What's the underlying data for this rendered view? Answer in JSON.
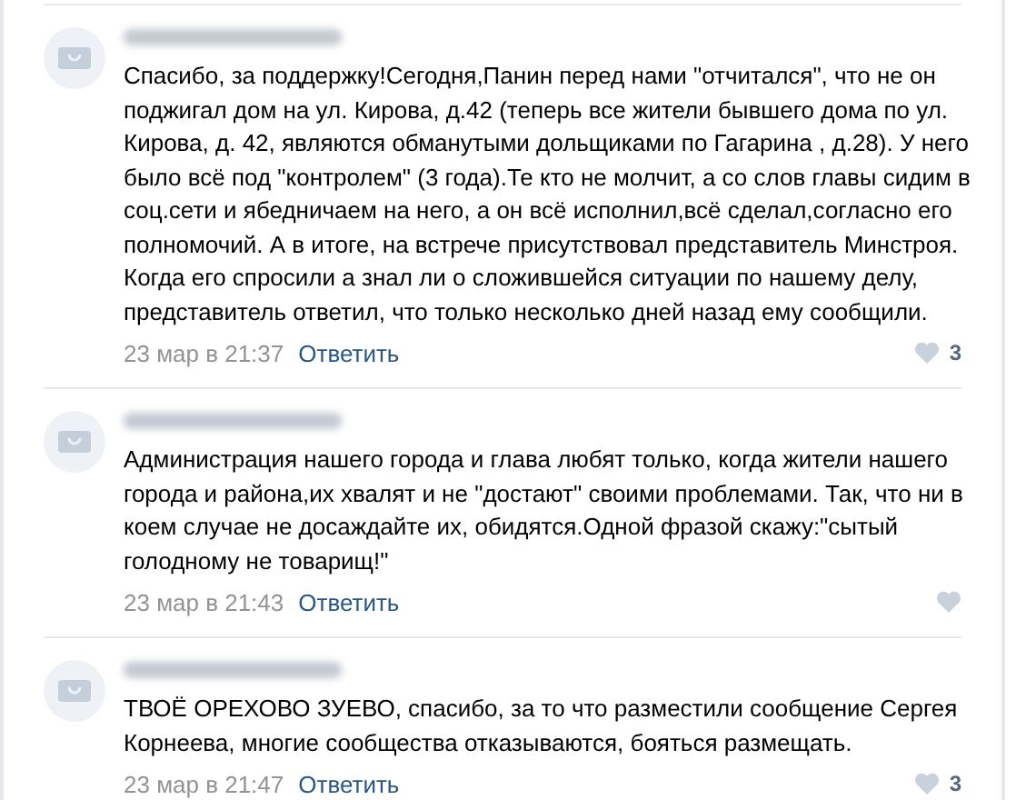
{
  "comments": [
    {
      "text": "Спасибо, за поддержку!Сегодня,Панин перед нами \"отчитался\", что не он поджигал дом на ул. Кирова, д.42 (теперь все жители бывшего дома по ул. Кирова, д. 42, являются обманутыми дольщиками по Гагарина , д.28). У него было всё под \"контролем\" (3 года).Те кто не молчит, а со слов главы сидим в соц.сети и ябедничаем на него, а он всё исполнил,всё сделал,согласно его полномочий. А в итоге, на встрече присутствовал представитель Минстроя. Когда его спросили а знал ли о сложившейся ситуации по нашему делу, представитель ответил, что только несколько дней назад ему сообщили.",
      "date": "23 мар в 21:37",
      "reply": "Ответить",
      "likes": "3"
    },
    {
      "text": "Администрация нашего города и глава любят только, когда жители нашего города и района,их хвалят и не \"достают\" своими проблемами. Так, что ни в коем случае не досаждайте их, обидятся.Одной фразой скажу:\"сытый голодному не товарищ!\"",
      "date": "23 мар в 21:43",
      "reply": "Ответить"
    },
    {
      "text": "ТВОЁ ОРЕХОВО ЗУЕВО, спасибо, за то что разместили сообщение Сергея Корнеева, многие сообщества отказываются, бояться размещать.",
      "date": "23 мар в 21:47",
      "reply": "Ответить",
      "likes": "3"
    }
  ]
}
